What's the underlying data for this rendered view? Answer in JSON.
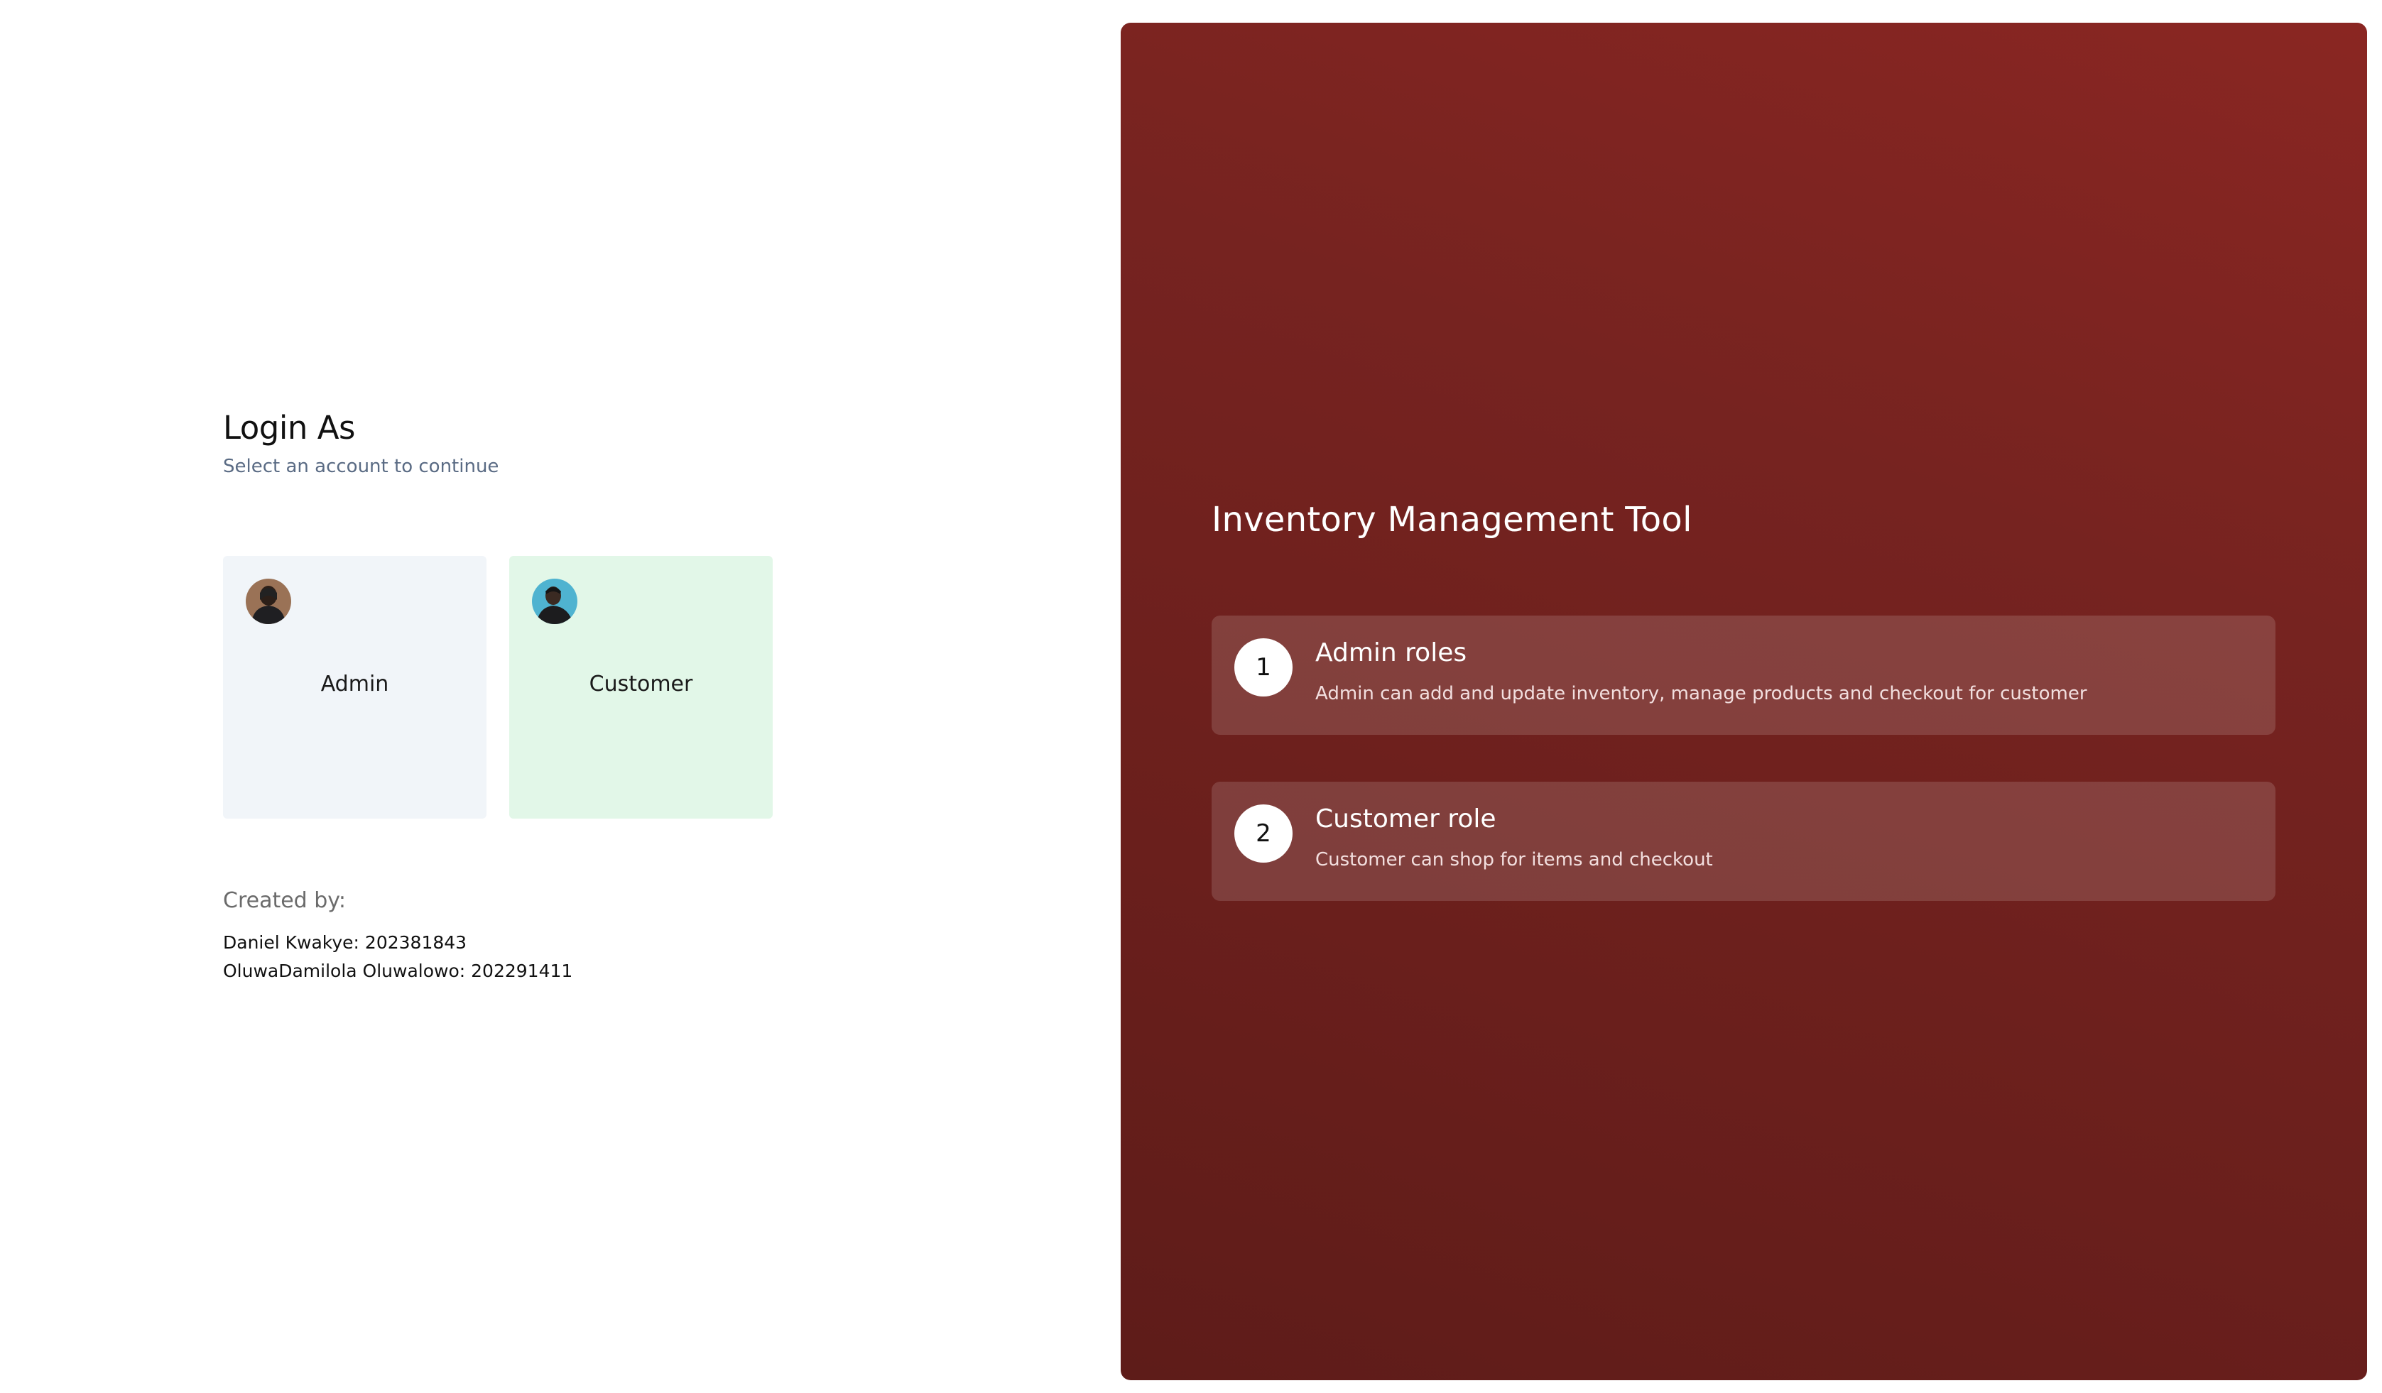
{
  "login": {
    "title": "Login As",
    "subtitle": "Select an account to continue"
  },
  "accounts": [
    {
      "label": "Admin",
      "icon": "admin-avatar-icon",
      "bg_color": "#f1f5f9"
    },
    {
      "label": "Customer",
      "icon": "customer-avatar-icon",
      "bg_color": "#e2f7e8"
    }
  ],
  "credits": {
    "heading": "Created by:",
    "authors": [
      "Daniel Kwakye: 202381843",
      "OluwaDamilola Oluwalowo: 202291411"
    ]
  },
  "panel": {
    "title": "Inventory Management Tool",
    "accent_color": "#7a2420",
    "roles": [
      {
        "number": "1",
        "title": "Admin roles",
        "description": "Admin can add and update inventory, manage products and checkout for customer"
      },
      {
        "number": "2",
        "title": "Customer role",
        "description": "Customer can shop for items and checkout"
      }
    ]
  }
}
